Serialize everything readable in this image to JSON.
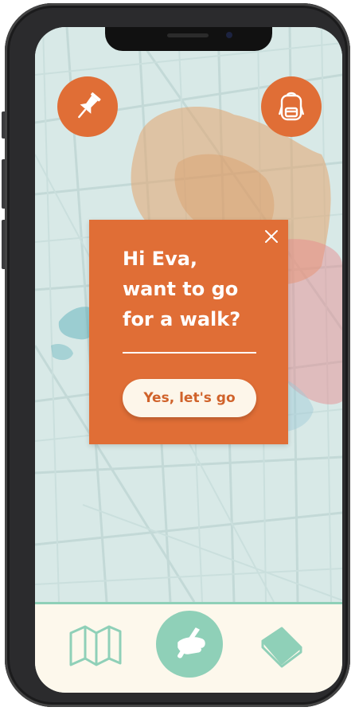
{
  "popup": {
    "greeting_line1": "Hi Eva,",
    "greeting_line2": "want to go",
    "greeting_line3": "for a walk?",
    "cta_label": "Yes, let's go"
  },
  "icons": {
    "pin": "pushpin-icon",
    "backpack": "backpack-icon",
    "close": "close-icon",
    "map": "map-icon",
    "draw": "hand-paintbrush-icon",
    "book": "book-icon"
  },
  "colors": {
    "accent": "#e06e36",
    "mint": "#8fd0b8",
    "cream": "#fdf8ec",
    "map_bg": "#d8e9e7"
  }
}
